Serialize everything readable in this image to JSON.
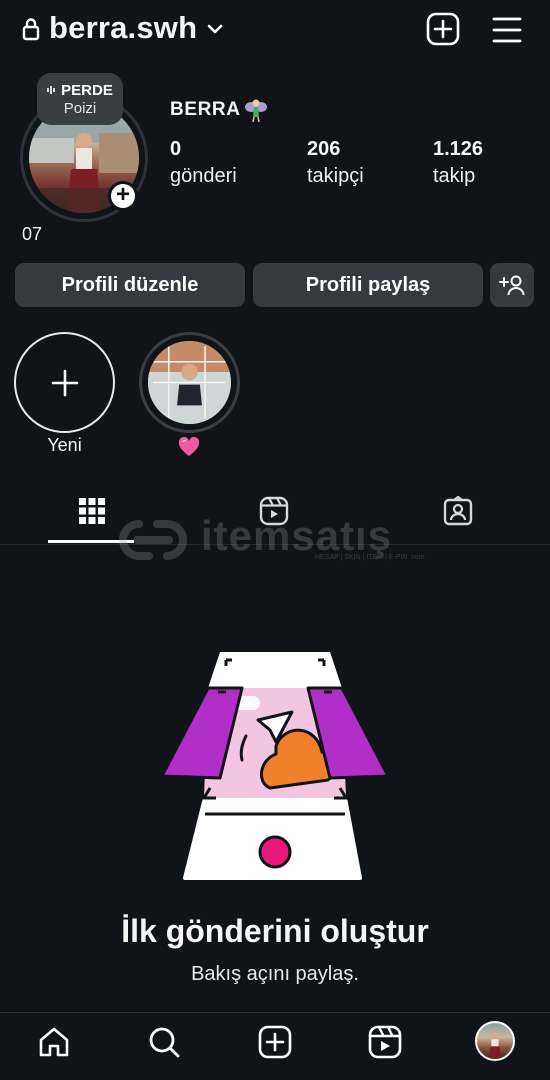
{
  "header": {
    "username": "berra.swh"
  },
  "profile": {
    "display_name": "BERRA",
    "note": {
      "title": "PERDE",
      "subtitle": "Poizi"
    },
    "under_avatar_text": "07",
    "stats": [
      {
        "value": "0",
        "label": "gönderi"
      },
      {
        "value": "206",
        "label": "takipçi"
      },
      {
        "value": "1.126",
        "label": "takip"
      }
    ]
  },
  "buttons": {
    "edit": "Profili düzenle",
    "share": "Profili paylaş"
  },
  "highlights": [
    {
      "label": "Yeni",
      "type": "new"
    },
    {
      "label": "",
      "type": "story",
      "emoji": "pink-heart"
    }
  ],
  "tabs": [
    {
      "icon": "grid-icon",
      "active": true
    },
    {
      "icon": "reels-icon",
      "active": false
    },
    {
      "icon": "tagged-icon",
      "active": false
    }
  ],
  "watermark": {
    "text": "itemsatış",
    "small": "HESAP | SKIN | İTEM | E-PIN .com"
  },
  "empty_state": {
    "title": "İlk gönderini oluştur",
    "subtitle": "Bakış açını paylaş."
  },
  "bottom_nav": [
    "home-icon",
    "search-icon",
    "create-icon",
    "reels-icon",
    "profile-avatar"
  ],
  "colors": {
    "background": "#101318",
    "button": "#363a40",
    "accent_purple": "#b12fc8",
    "accent_orange": "#f0802a",
    "accent_pink": "#e8197a"
  }
}
